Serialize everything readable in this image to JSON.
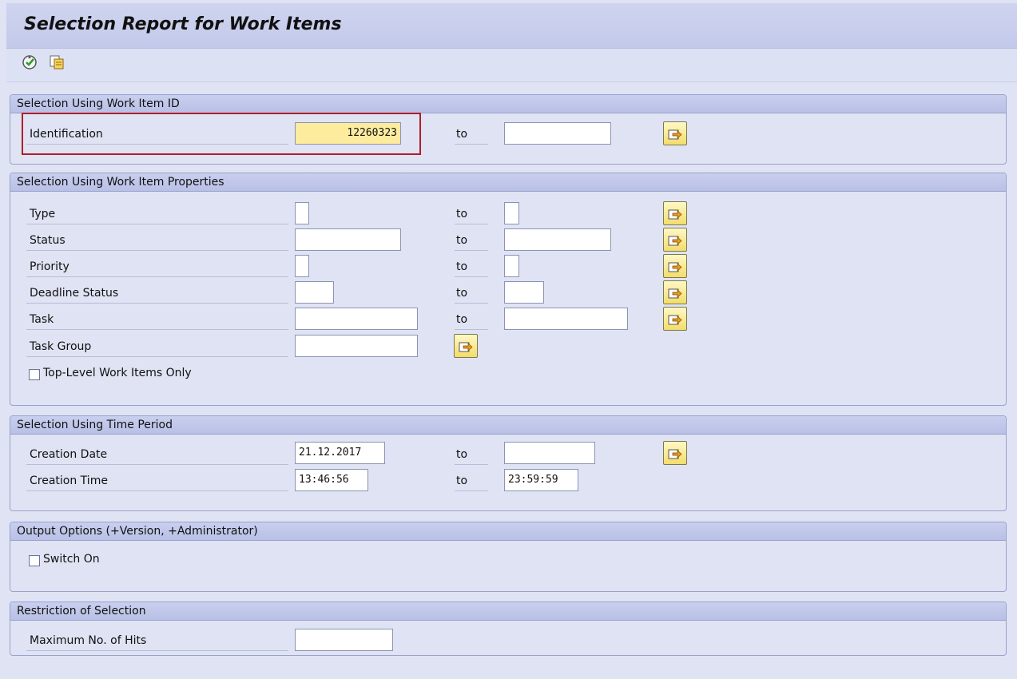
{
  "title": "Selection Report for Work Items",
  "toolbar": {
    "execute_icon": "execute-icon",
    "variants_icon": "copy-variants-icon"
  },
  "sections": {
    "workitem_id": {
      "header": "Selection Using Work Item ID",
      "identification": {
        "label": "Identification",
        "from": "12260323",
        "to_label": "to",
        "to": ""
      }
    },
    "properties": {
      "header": "Selection Using Work Item Properties",
      "type": {
        "label": "Type",
        "from": "",
        "to_label": "to",
        "to": ""
      },
      "status": {
        "label": "Status",
        "from": "",
        "to_label": "to",
        "to": ""
      },
      "priority": {
        "label": "Priority",
        "from": "",
        "to_label": "to",
        "to": ""
      },
      "deadline": {
        "label": "Deadline Status",
        "from": "",
        "to_label": "to",
        "to": ""
      },
      "task": {
        "label": "Task",
        "from": "",
        "to_label": "to",
        "to": ""
      },
      "task_group": {
        "label": "Task Group",
        "from": ""
      },
      "top_level": {
        "label": "Top-Level Work Items Only",
        "checked": false
      }
    },
    "time": {
      "header": "Selection Using Time Period",
      "creation_date": {
        "label": "Creation Date",
        "from": "21.12.2017",
        "to_label": "to",
        "to": ""
      },
      "creation_time": {
        "label": "Creation Time",
        "from": "13:46:56",
        "to_label": "to",
        "to": "23:59:59"
      }
    },
    "output": {
      "header": "Output Options (+Version, +Administrator)",
      "switch_on": {
        "label": "Switch On",
        "checked": false
      }
    },
    "restriction": {
      "header": "Restriction of Selection",
      "max_hits": {
        "label": "Maximum No. of Hits",
        "value": ""
      }
    }
  },
  "colors": {
    "highlight_field": "#fdeb9e",
    "annotation_box": "#b01e2a",
    "panel_header": "#c3c9ea"
  }
}
